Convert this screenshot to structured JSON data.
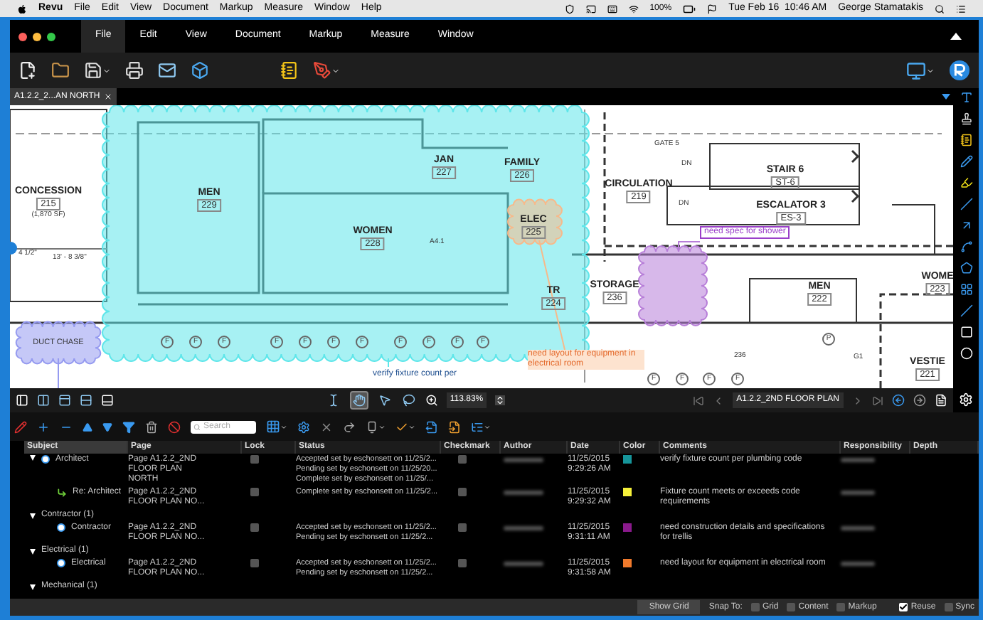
{
  "menu_bar": {
    "app": "Revu",
    "items": [
      "File",
      "Edit",
      "View",
      "Document",
      "Markup",
      "Measure",
      "Window",
      "Help"
    ],
    "battery": "100%",
    "clock": "Tue Feb 16  10:46 AM",
    "user": "George Stamatakis"
  },
  "app_tabs": [
    {
      "label": "File",
      "selected": true
    },
    {
      "label": "Edit",
      "selected": false
    },
    {
      "label": "View",
      "selected": false
    },
    {
      "label": "Document",
      "selected": false
    },
    {
      "label": "Markup",
      "selected": false
    },
    {
      "label": "Measure",
      "selected": false
    },
    {
      "label": "Window",
      "selected": false
    }
  ],
  "document_tab": {
    "label": "A1.2.2_2...AN NORTH"
  },
  "plan": {
    "rooms": [
      {
        "name": "CONCESSION",
        "number": "215",
        "area": "(1,870 SF)"
      },
      {
        "name": "MEN",
        "number": "229"
      },
      {
        "name": "WOMEN",
        "number": "228"
      },
      {
        "name": "JAN",
        "number": "227"
      },
      {
        "name": "FAMILY",
        "number": "226"
      },
      {
        "name": "ELEC",
        "number": "225"
      },
      {
        "name": "TR",
        "number": "224"
      },
      {
        "name": "CIRCULATION",
        "number": "219"
      },
      {
        "name": "STAIR 6",
        "number": "ST-6"
      },
      {
        "name": "ESCALATOR 3",
        "number": "ES-3"
      },
      {
        "name": "STORAGE",
        "number": "236"
      },
      {
        "name": "MEN",
        "number": "222"
      },
      {
        "name": "WOME",
        "number": "223"
      },
      {
        "name": "VESTIE",
        "number": "221"
      }
    ],
    "labels": [
      {
        "text": "GATE 5"
      },
      {
        "text": "DN"
      },
      {
        "text": "DN"
      },
      {
        "text": "4 1/2\""
      },
      {
        "text": "13' - 8 3/8\""
      },
      {
        "text": "236"
      },
      {
        "text": "G1"
      },
      {
        "text": "A4.1"
      }
    ],
    "tags": [
      {
        "text": "F"
      },
      {
        "text": "F"
      },
      {
        "text": "F"
      },
      {
        "text": "F"
      },
      {
        "text": "F"
      },
      {
        "text": "F"
      },
      {
        "text": "F"
      },
      {
        "text": "F"
      },
      {
        "text": "F"
      },
      {
        "text": "F"
      },
      {
        "text": "F"
      },
      {
        "text": "F"
      },
      {
        "text": "F"
      },
      {
        "text": "F"
      },
      {
        "text": "F"
      },
      {
        "text": "P"
      }
    ],
    "markups": [
      {
        "kind": "cloud",
        "note": "verify fixture count per",
        "color": "#5fe6ea"
      },
      {
        "kind": "cloud",
        "note": "need layout for equipment in electrical room",
        "color": "#f7b98a"
      },
      {
        "kind": "cloud",
        "note": "need spec for shower",
        "color": "#b77ed8"
      },
      {
        "kind": "cloud",
        "label": "DUCT CHASE",
        "color": "#959af0"
      }
    ]
  },
  "canvas_toolbar": {
    "tools": [
      {
        "kind": "text-select",
        "selected": false
      },
      {
        "kind": "hand",
        "selected": true
      },
      {
        "kind": "pointer",
        "selected": false
      },
      {
        "kind": "lasso",
        "selected": false
      }
    ],
    "zoom": "113.83%",
    "page": "A1.2.2_2ND FLOOR PLAN"
  },
  "markup_list": {
    "search": {
      "placeholder": "Search"
    },
    "columns": [
      "Subject",
      "Page",
      "Lock",
      "Status",
      "Checkmark",
      "Author",
      "Date",
      "Color",
      "Comments",
      "Responsibility",
      "Depth"
    ],
    "rows": [
      {
        "kind": "markup",
        "subject": "Architect",
        "expanded": true,
        "page": [
          "Page A1.2.2_2ND",
          "FLOOR PLAN",
          "NORTH"
        ],
        "locked": false,
        "status": [
          "Accepted set by eschonsett on 11/25/2...",
          "Pending set by eschonsett on 11/25/20...",
          "Complete set by eschonsett on 11/25/..."
        ],
        "checked": false,
        "date": [
          "11/25/2015",
          "9:29:26 AM"
        ],
        "color": "#16959a",
        "comment": "verify fixture count per plumbing code",
        "children": [
          {
            "kind": "reply",
            "subject": "Re: Architect",
            "page": [
              "Page A1.2.2_2ND",
              "FLOOR PLAN NO..."
            ],
            "locked": false,
            "status": [
              "Complete set by eschonsett on 11/25/2..."
            ],
            "checked": false,
            "date": [
              "11/25/2015",
              "9:29:32 AM"
            ],
            "color": "#f5f03a",
            "comment": "Fixture count meets or exceeds code requirements"
          }
        ]
      },
      {
        "kind": "group",
        "subject": "Contractor (1)",
        "expanded": true,
        "children": [
          {
            "kind": "markup",
            "subject": "Contractor",
            "page": [
              "Page A1.2.2_2ND",
              "FLOOR PLAN NO..."
            ],
            "locked": false,
            "status": [
              "Accepted set by eschonsett on 11/25/2...",
              "Pending set by eschonsett on 11/25/2..."
            ],
            "checked": false,
            "date": [
              "11/25/2015",
              "9:31:11 AM"
            ],
            "color": "#8a1a8c",
            "comment": "need construction details and specifications for trellis"
          }
        ]
      },
      {
        "kind": "group",
        "subject": "Electrical (1)",
        "expanded": true,
        "children": [
          {
            "kind": "markup",
            "subject": "Electrical",
            "page": [
              "Page A1.2.2_2ND",
              "FLOOR PLAN NO..."
            ],
            "locked": false,
            "status": [
              "Accepted set by eschonsett on 11/25/2...",
              "Pending set by eschonsett on 11/25/2..."
            ],
            "checked": false,
            "date": [
              "11/25/2015",
              "9:31:58 AM"
            ],
            "color": "#f07a2c",
            "comment": "need layout for equipment in electrical room"
          }
        ]
      },
      {
        "kind": "group",
        "subject": "Mechanical (1)",
        "expanded": true
      }
    ]
  },
  "status_bar": {
    "button": "Show Grid",
    "snap_label": "Snap To:",
    "options": [
      {
        "label": "Grid",
        "checked": false
      },
      {
        "label": "Content",
        "checked": false
      },
      {
        "label": "Markup",
        "checked": false
      },
      {
        "label": "Reuse",
        "checked": true
      },
      {
        "label": "Sync",
        "checked": false
      }
    ]
  }
}
